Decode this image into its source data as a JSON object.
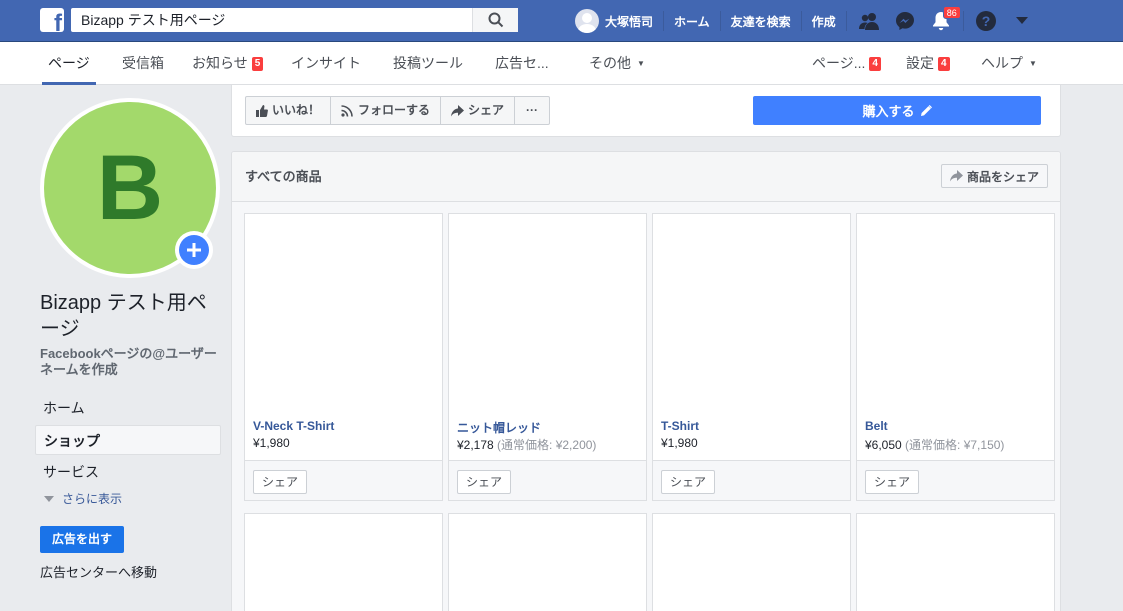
{
  "topbar": {
    "search_value": "Bizapp テスト用ページ",
    "user_name": "大塚悟司",
    "home": "ホーム",
    "find_friends": "友達を検索",
    "create": "作成",
    "notifications_count": "86",
    "icons": [
      "facebook-logo",
      "search-icon",
      "friends-icon",
      "messenger-icon",
      "bell-icon",
      "help-icon",
      "chevron-down-icon"
    ]
  },
  "subnav": {
    "tabs": [
      {
        "label": "ページ"
      },
      {
        "label": "受信箱"
      },
      {
        "label": "お知らせ",
        "badge": "5"
      },
      {
        "label": "インサイト"
      },
      {
        "label": "投稿ツール"
      },
      {
        "label": "広告セ..."
      },
      {
        "label": "その他"
      }
    ],
    "right": [
      {
        "label": "ページ...",
        "badge": "4"
      },
      {
        "label": "設定",
        "badge": "4"
      },
      {
        "label": "ヘルプ"
      }
    ]
  },
  "sidebar": {
    "avatar_letter": "B",
    "page_name": "Bizapp テスト用ページ",
    "username_prompt": "Facebookページの@ユーザーネームを作成",
    "items": [
      {
        "label": "ホーム"
      },
      {
        "label": "ショップ"
      },
      {
        "label": "サービス"
      }
    ],
    "more": "さらに表示",
    "ad_button": "広告を出す",
    "ad_center": "広告センターへ移動"
  },
  "actions": {
    "like": "いいね！",
    "follow": "フォローする",
    "share": "シェア",
    "more": "···",
    "buy": "購入する"
  },
  "products": {
    "title": "すべての商品",
    "share_label": "商品をシェア",
    "items": [
      {
        "name": "V-Neck T-Shirt",
        "price": "¥1,980",
        "original": "",
        "share": "シェア"
      },
      {
        "name": "ニット帽レッド",
        "price": "¥2,178",
        "original": "(通常価格: ¥2,200)",
        "share": "シェア"
      },
      {
        "name": "T-Shirt",
        "price": "¥1,980",
        "original": "",
        "share": "シェア"
      },
      {
        "name": "Belt",
        "price": "¥6,050",
        "original": "(通常価格: ¥7,150)",
        "share": "シェア"
      }
    ]
  },
  "colors": {
    "brand": "#4267b2",
    "primary_button": "#4080ff",
    "avatar_bg": "#a3d96b",
    "avatar_letter": "#2f7a2a",
    "badge": "#fa3e3e"
  }
}
